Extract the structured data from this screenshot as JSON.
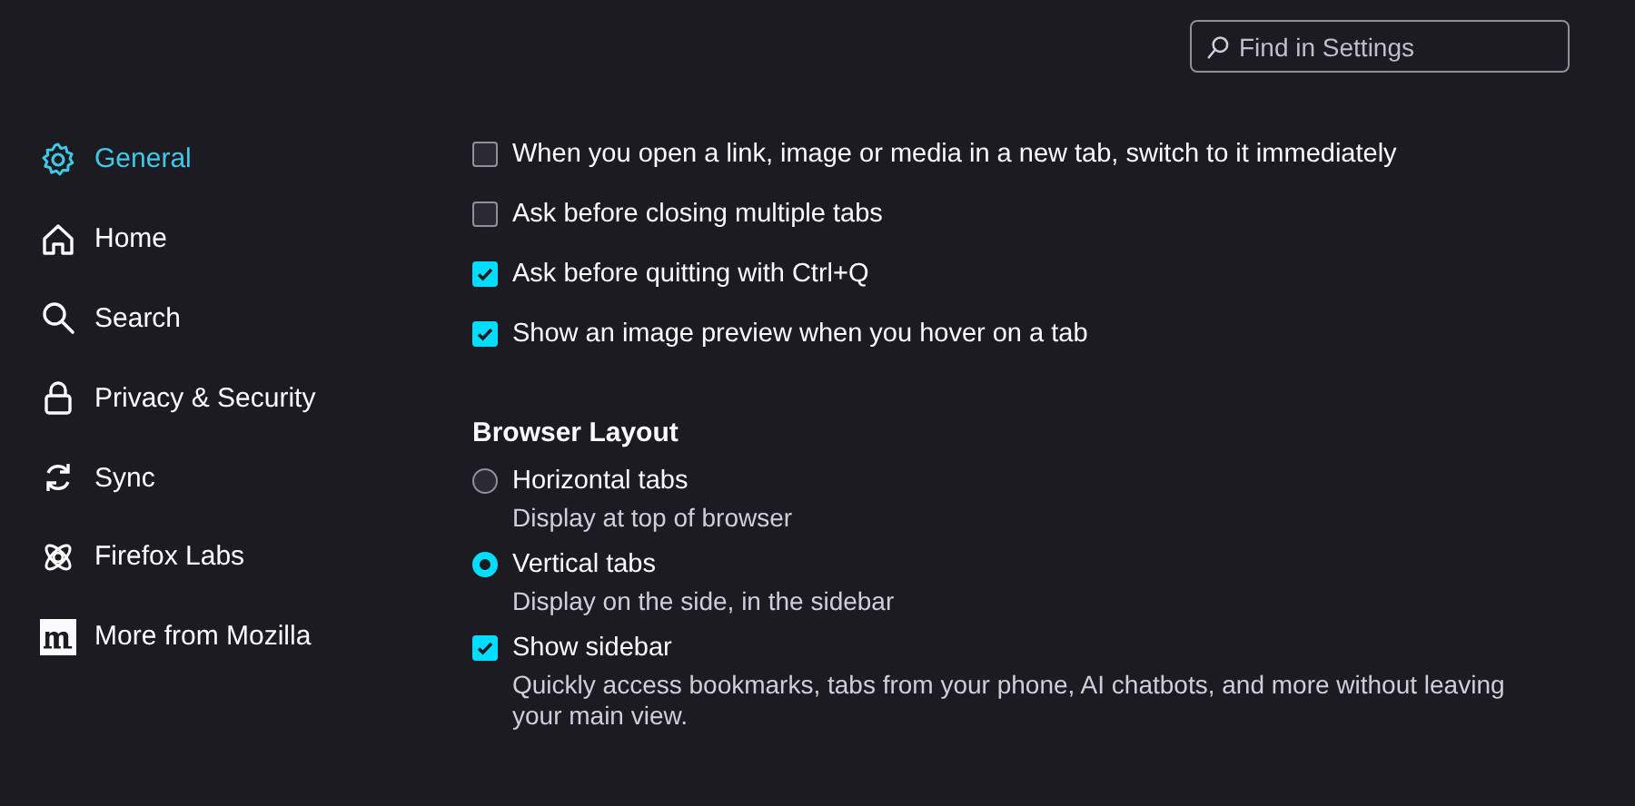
{
  "search": {
    "placeholder": "Find in Settings"
  },
  "sidebar": {
    "items": [
      {
        "label": "General",
        "selected": true
      },
      {
        "label": "Home",
        "selected": false
      },
      {
        "label": "Search",
        "selected": false
      },
      {
        "label": "Privacy & Security",
        "selected": false
      },
      {
        "label": "Sync",
        "selected": false
      },
      {
        "label": "Firefox Labs",
        "selected": false
      },
      {
        "label": "More from Mozilla",
        "selected": false
      }
    ]
  },
  "tab_options": [
    {
      "label": "When you open a link, image or media in a new tab, switch to it immediately",
      "checked": false
    },
    {
      "label": "Ask before closing multiple tabs",
      "checked": false
    },
    {
      "label": "Ask before quitting with Ctrl+Q",
      "checked": true
    },
    {
      "label": "Show an image preview when you hover on a tab",
      "checked": true
    }
  ],
  "browser_layout": {
    "heading": "Browser Layout",
    "options": [
      {
        "kind": "radio",
        "label": "Horizontal tabs",
        "description": "Display at top of browser",
        "selected": false
      },
      {
        "kind": "radio",
        "label": "Vertical tabs",
        "description": "Display on the side, in the sidebar",
        "selected": true
      },
      {
        "kind": "checkbox",
        "label": "Show sidebar",
        "description": "Quickly access bookmarks, tabs from your phone, AI chatbots, and more without leaving your main view.",
        "checked": true
      }
    ]
  }
}
